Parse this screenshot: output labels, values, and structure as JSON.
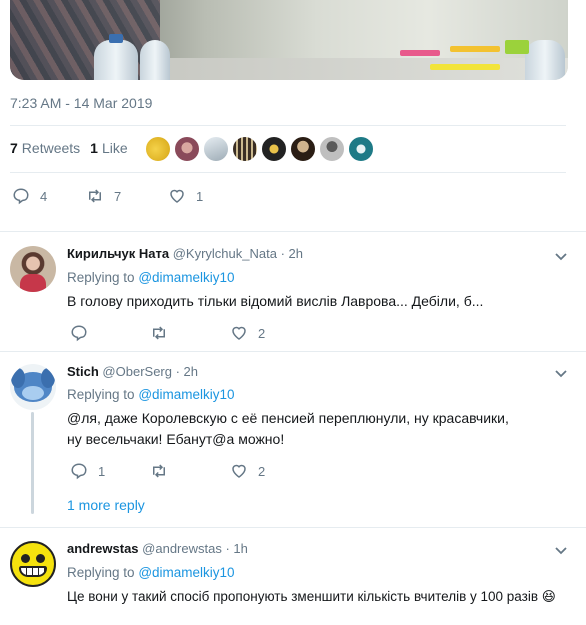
{
  "tweet": {
    "timestamp": "7:23 AM - 14 Mar 2019",
    "retweets_count": "7",
    "retweets_label": "Retweets",
    "likes_count": "1",
    "likes_label": "Like",
    "liker_avatar_colors": [
      "#f1c232",
      "#8a4a5a",
      "#b7c3cc",
      "#5a4a3a",
      "#222222",
      "#3a2a20",
      "#8c8c8c",
      "#1e7a86"
    ],
    "actions": {
      "replies": "4",
      "retweets": "7",
      "likes": "1"
    }
  },
  "replies": [
    {
      "name": "Кирильчук Ната",
      "handle": "@Kyrylchuk_Nata",
      "time": "2h",
      "replying_label": "Replying to",
      "replying_to": "@dimamelkiy10",
      "text": "В голову приходить тільки відомий вислів Лаврова... Дебіли, б...",
      "actions": {
        "replies": "",
        "retweets": "",
        "likes": "2"
      }
    },
    {
      "name": "Stich",
      "handle": "@OberSerg",
      "time": "2h",
      "replying_label": "Replying to",
      "replying_to": "@dimamelkiy10",
      "text": "@ля, даже Королевскую с её пенсией переплюнули, ну красавчики, ну весельчаки! Ебанут@а можно!",
      "actions": {
        "replies": "1",
        "retweets": "",
        "likes": "2"
      },
      "more_replies": "1 more reply"
    },
    {
      "name": "andrewstas",
      "handle": "@andrewstas",
      "time": "1h",
      "replying_label": "Replying to",
      "replying_to": "@dimamelkiy10",
      "text": "Це вони у такий спосіб пропонують зменшити кількість вчителів у 100 разів 😆"
    }
  ],
  "icons": {
    "reply": "reply-icon",
    "retweet": "retweet-icon",
    "like": "heart-icon",
    "menu": "chevron-down-icon"
  }
}
